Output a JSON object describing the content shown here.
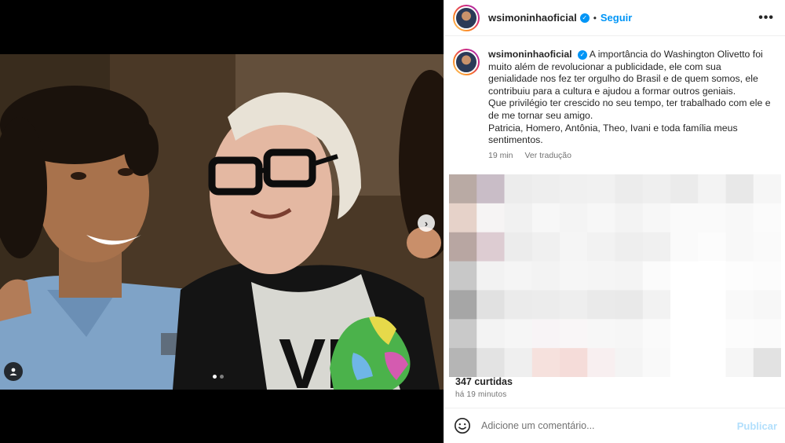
{
  "post": {
    "username": "wsimoninhaofical",
    "follow_label": "Seguir",
    "separator": "•",
    "verified_icon": "verified-badge-icon",
    "more_label": "•••"
  },
  "caption": {
    "username": "wsimoninhaoficial",
    "lines": [
      "A importância do Washington Olivetto foi muito além de revolucionar a publicidade, ele com sua genialidade nos fez ter orgulho do Brasil e de quem somos, ele contribuiu para a cultura e ajudou a formar outros geniais.",
      "Que privilégio ter crescido no seu tempo, ter trabalhado com ele e de me tornar seu amigo.",
      "Patricia, Homero, Antônia, Theo, Ivani e toda família meus sentimentos."
    ],
    "time": "19 min",
    "translate": "Ver tradução"
  },
  "stats": {
    "likes": "347 curtidas",
    "posted": "há 19 minutos"
  },
  "comment_box": {
    "placeholder": "Adicione um comentário...",
    "publish": "Publicar"
  },
  "media": {
    "next_icon": "chevron-right-icon",
    "next_label": "›",
    "tag_icon": "user-tag-icon",
    "slide_count": 2,
    "active_slide": 1
  },
  "colors": {
    "accent": "#0095f6",
    "publish_disabled": "#b2dffc",
    "muted": "#737373"
  }
}
